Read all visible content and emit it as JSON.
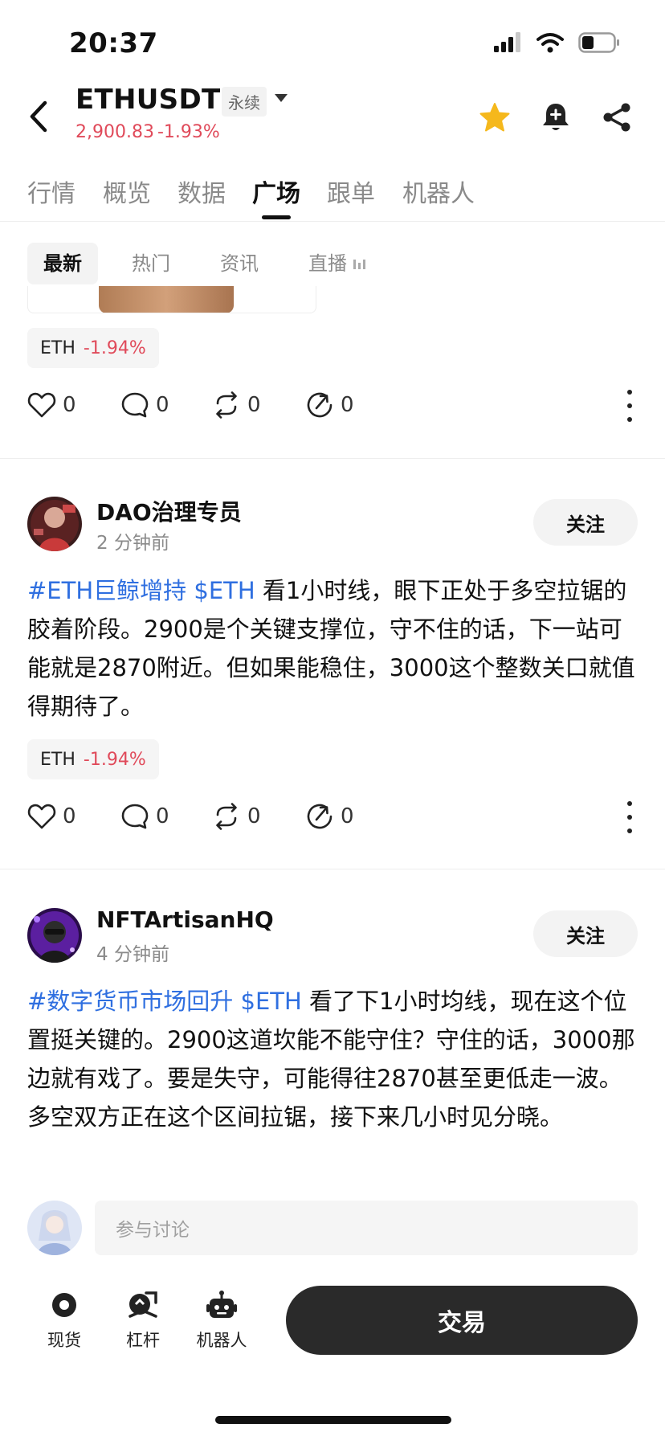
{
  "status_bar": {
    "time": "20:37"
  },
  "header": {
    "symbol": "ETHUSDT",
    "contract_type": "永续",
    "price": "2,900.83",
    "change": "-1.93%",
    "colors": {
      "down": "#e04a5a",
      "star": "#f5b81c"
    }
  },
  "tabs": [
    {
      "label": "行情"
    },
    {
      "label": "概览"
    },
    {
      "label": "数据"
    },
    {
      "label": "广场",
      "active": true
    },
    {
      "label": "跟单"
    },
    {
      "label": "机器人"
    }
  ],
  "subtabs": [
    {
      "label": "最新",
      "active": true
    },
    {
      "label": "热门"
    },
    {
      "label": "资讯"
    },
    {
      "label": "直播"
    }
  ],
  "posts": [
    {
      "chip": {
        "symbol": "ETH",
        "change": "-1.94%"
      },
      "stats": {
        "likes": "0",
        "comments": "0",
        "reposts": "0",
        "shares": "0"
      }
    },
    {
      "author": "DAO治理专员",
      "time": "2 分钟前",
      "follow_label": "关注",
      "hashtag": "#ETH巨鲸增持",
      "cashtag": "$ETH",
      "text": " 看1小时线，眼下正处于多空拉锯的胶着阶段。2900是个关键支撑位，守不住的话，下一站可能就是2870附近。但如果能稳住，3000这个整数关口就值得期待了。",
      "chip": {
        "symbol": "ETH",
        "change": "-1.94%"
      },
      "stats": {
        "likes": "0",
        "comments": "0",
        "reposts": "0",
        "shares": "0"
      }
    },
    {
      "author": "NFTArtisanHQ",
      "time": "4 分钟前",
      "follow_label": "关注",
      "hashtag": "#数字货币市场回升",
      "cashtag": "$ETH",
      "text": " 看了下1小时均线，现在这个位置挺关键的。2900这道坎能不能守住？守住的话，3000那边就有戏了。要是失守，可能得往2870甚至更低走一波。多空双方正在这个区间拉锯，接下来几小时见分晓。"
    }
  ],
  "comment": {
    "placeholder": "参与讨论"
  },
  "bottom_nav": {
    "items": [
      {
        "label": "现货",
        "icon": "spot-icon"
      },
      {
        "label": "杠杆",
        "icon": "margin-icon"
      },
      {
        "label": "机器人",
        "icon": "robot-icon"
      }
    ],
    "trade_label": "交易"
  }
}
